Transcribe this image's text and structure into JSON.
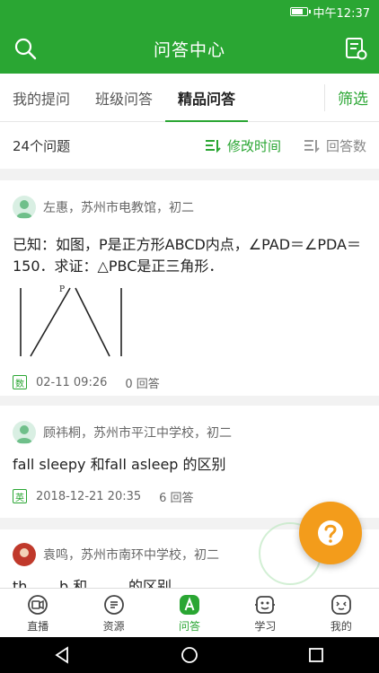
{
  "status_bar": {
    "time": "中午12:37"
  },
  "app_bar": {
    "title": "问答中心",
    "left_icon": "search-icon",
    "right_icon": "notepad-icon"
  },
  "tabs": [
    {
      "label": "我的提问",
      "active": false
    },
    {
      "label": "班级问答",
      "active": false
    },
    {
      "label": "精品问答",
      "active": true
    }
  ],
  "filter_label": "筛选",
  "sort_bar": {
    "count": "24个问题",
    "sort_time": "修改时间",
    "sort_answers": "回答数"
  },
  "questions": [
    {
      "author": "左惠，苏州市电教馆，初二",
      "text": "已知：如图，P是正方形ABCD内点，∠PAD＝∠PDA＝150．求证：△PBC是正三角形．",
      "figure_label": "P",
      "subject": "数",
      "time": "02-11 09:26",
      "answers": "0 回答"
    },
    {
      "author": "顾祎桐，苏州市平江中学校，初二",
      "text": "fall sleepy 和fall asleep 的区别",
      "subject": "英",
      "time": "2018-12-21 20:35",
      "answers": "6 回答"
    },
    {
      "author": "袁鸣，苏州市南环中学校，初二",
      "text": "th... ...b 和 ... ... 的区别"
    }
  ],
  "fab_icon": "question-icon",
  "bottom_nav": [
    {
      "label": "直播",
      "icon": "live-icon",
      "active": false
    },
    {
      "label": "资源",
      "icon": "document-icon",
      "active": false
    },
    {
      "label": "问答",
      "icon": "qa-icon",
      "active": true
    },
    {
      "label": "学习",
      "icon": "study-icon",
      "active": false
    },
    {
      "label": "我的",
      "icon": "profile-icon",
      "active": false
    }
  ],
  "colors": {
    "brand": "#2aa633",
    "accent": "#f39c1b"
  }
}
